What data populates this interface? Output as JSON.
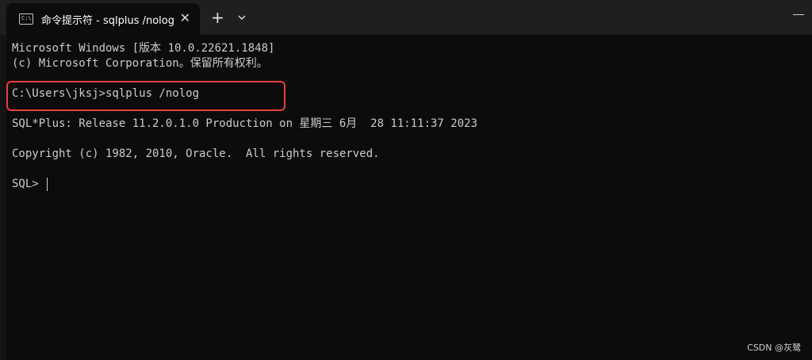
{
  "window": {
    "tab_icon_text": "C:\\",
    "tab_title": "命令提示符 - sqlplus  /nolog",
    "tab_close": "✕",
    "new_tab": "+",
    "dropdown_icon": "chevron-down-icon",
    "minimize_icon": "minimize-icon"
  },
  "terminal": {
    "lines": [
      "Microsoft Windows [版本 10.0.22621.1848]",
      "(c) Microsoft Corporation。保留所有权利。",
      "C:\\Users\\jksj>sqlplus /nolog",
      "SQL*Plus: Release 11.2.0.1.0 Production on 星期三 6月  28 11:11:37 2023",
      "Copyright (c) 1982, 2010, Oracle.  All rights reserved.",
      "SQL> "
    ]
  },
  "highlight_color": "#e8413a",
  "watermark": "CSDN @灰鹭"
}
